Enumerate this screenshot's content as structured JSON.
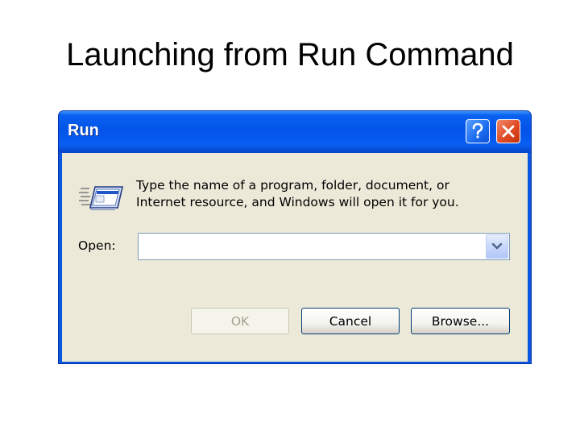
{
  "slide": {
    "title": "Launching from Run Command"
  },
  "dialog": {
    "title": "Run",
    "prompt_line1": "Type the name of a program, folder, document, or",
    "prompt_line2": "Internet resource, and Windows will open it for you.",
    "open_label": "Open:",
    "open_value": "",
    "buttons": {
      "ok": "OK",
      "cancel": "Cancel",
      "browse": "Browse..."
    },
    "icons": {
      "help": "question-mark-icon",
      "close": "close-icon",
      "run": "run-program-icon",
      "dropdown": "chevron-down-icon"
    },
    "colors": {
      "titlebar": "#0a5ef2",
      "client": "#ece9d8",
      "close_button": "#e04a23"
    }
  }
}
